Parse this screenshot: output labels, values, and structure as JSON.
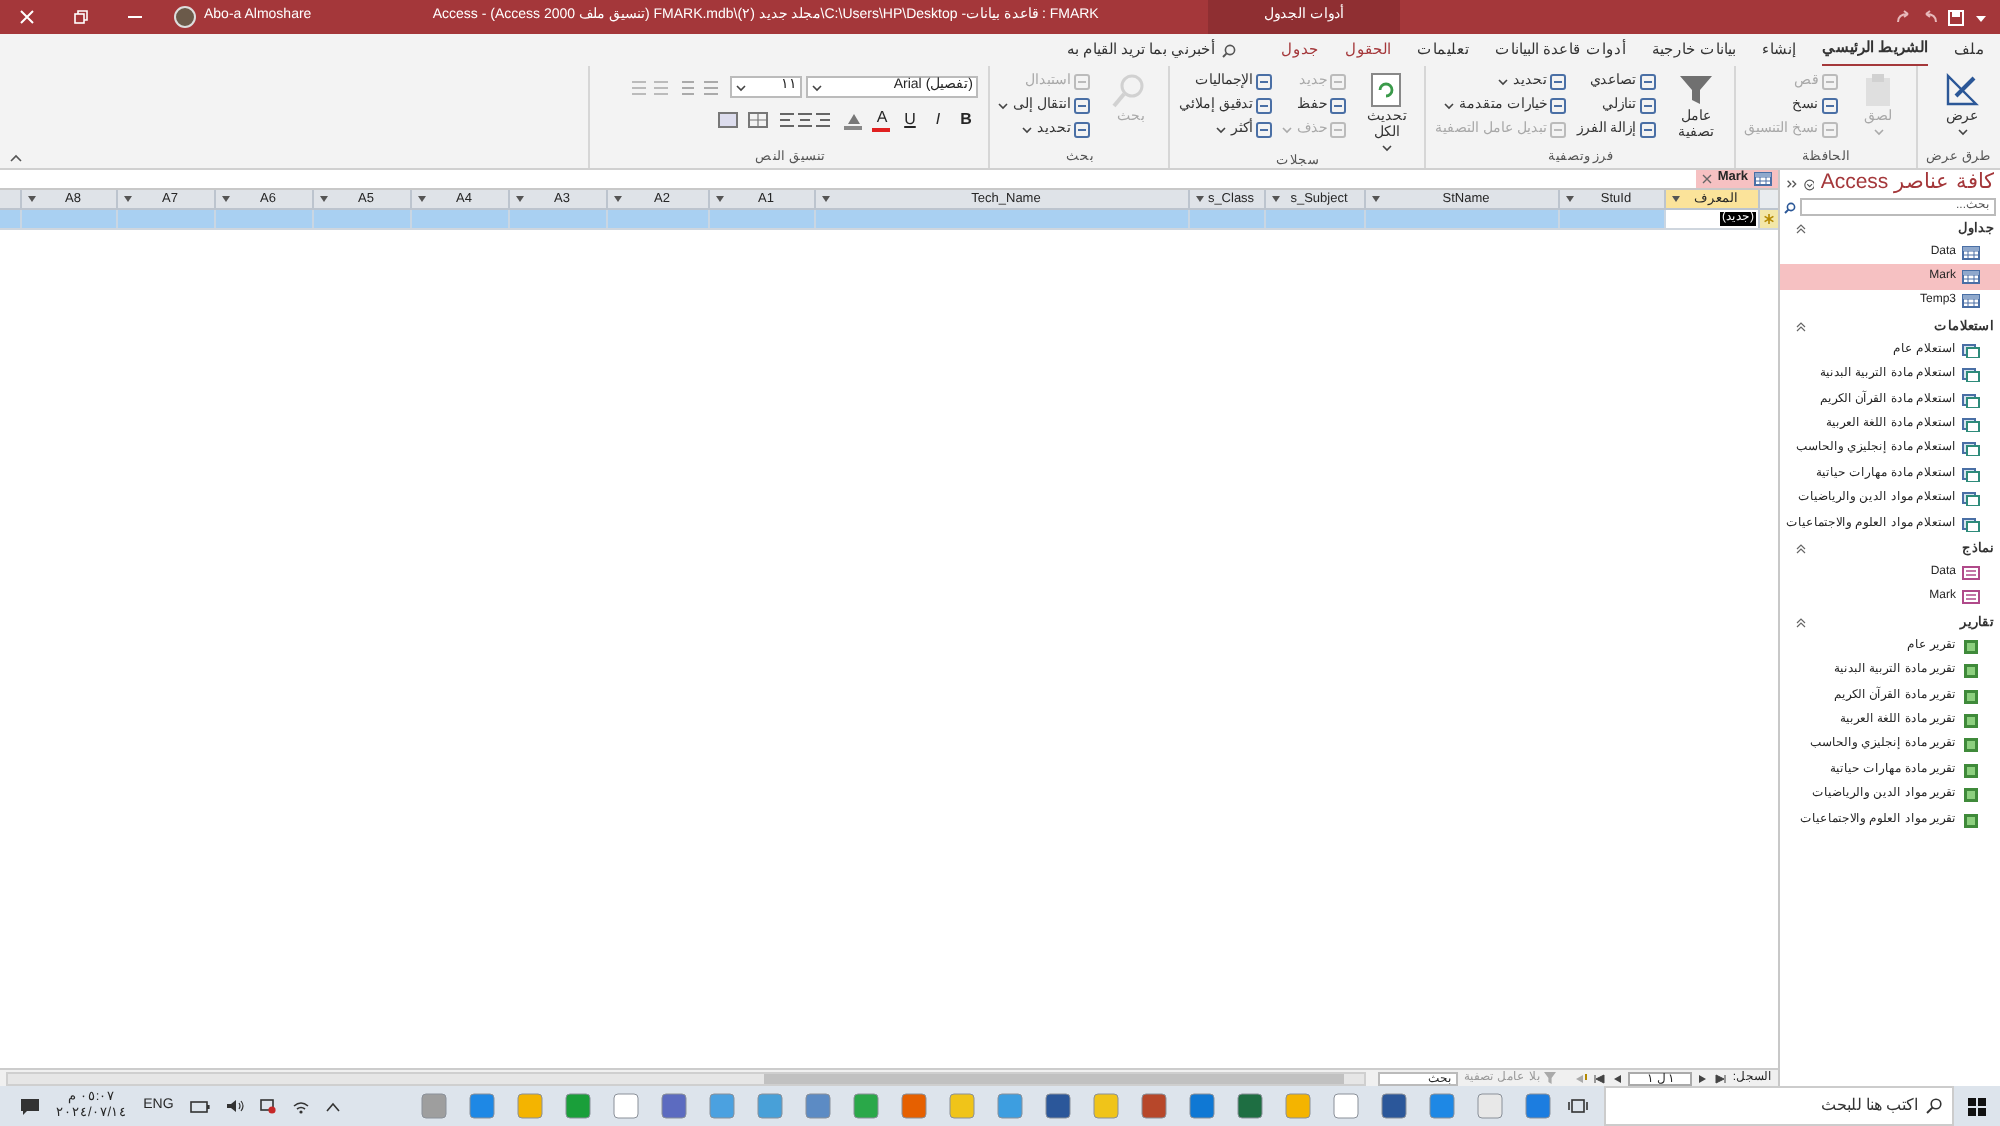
{
  "title_bar": {
    "user_name": "Abo-a Almoshare",
    "title": "FMARK : قاعدة بيانات- C:\\Users\\HP\\Desktop\\مجلد جديد (٢)\\FMARK.mdb (تنسيق ملف Access 2000) - Access",
    "context_tab": "أدوات الجدول"
  },
  "ribbon": {
    "tabs": [
      {
        "label": "ملف",
        "kind": "normal",
        "selected": false
      },
      {
        "label": "الشريط الرئيسي",
        "kind": "normal",
        "selected": true
      },
      {
        "label": "إنشاء",
        "kind": "normal",
        "selected": false
      },
      {
        "label": "بيانات خارجية",
        "kind": "normal",
        "selected": false
      },
      {
        "label": "أدوات قاعدة البيانات",
        "kind": "normal",
        "selected": false
      },
      {
        "label": "تعليمات",
        "kind": "normal",
        "selected": false
      },
      {
        "label": "الحقول",
        "kind": "context",
        "selected": false
      },
      {
        "label": "جدول",
        "kind": "context",
        "selected": false
      }
    ],
    "tell_me": "أخبرني بما تريد القيام به",
    "groups": [
      {
        "kind": "views",
        "label": "طرق عرض",
        "buttons": [
          {
            "label": "عرض",
            "kind": "large",
            "dropdown": true,
            "disabled": false
          }
        ]
      },
      {
        "kind": "clipboard",
        "label": "الحافظة",
        "buttons": [
          {
            "label": "لصق",
            "kind": "large",
            "dropdown": true,
            "disabled": true
          },
          {
            "label": "قص",
            "kind": "small",
            "dropdown": false,
            "disabled": true
          },
          {
            "label": "نسخ",
            "kind": "small",
            "dropdown": false,
            "disabled": false
          },
          {
            "label": "نسخ التنسيق",
            "kind": "small",
            "dropdown": false,
            "disabled": true
          }
        ]
      },
      {
        "kind": "sort",
        "label": "فرز وتصفية",
        "buttons": [
          {
            "label": "عامل تصفية",
            "kind": "large",
            "dropdown": false,
            "disabled": false
          },
          {
            "label": "تصاعدي",
            "kind": "small",
            "dropdown": false,
            "disabled": false
          },
          {
            "label": "تنازلي",
            "kind": "small",
            "dropdown": false,
            "disabled": false
          },
          {
            "label": "إزالة الفرز",
            "kind": "small",
            "dropdown": false,
            "disabled": false
          },
          {
            "label": "تحديد",
            "kind": "small",
            "dropdown": true,
            "disabled": false
          },
          {
            "label": "خيارات متقدمة",
            "kind": "small",
            "dropdown": true,
            "disabled": false
          },
          {
            "label": "تبديل عامل التصفية",
            "kind": "small",
            "dropdown": false,
            "disabled": true
          }
        ]
      },
      {
        "kind": "records",
        "label": "سجلات",
        "buttons": [
          {
            "label": "تحديث الكل",
            "kind": "large",
            "dropdown": true,
            "disabled": false
          },
          {
            "label": "جديد",
            "kind": "small",
            "dropdown": false,
            "disabled": true
          },
          {
            "label": "حفظ",
            "kind": "small",
            "dropdown": false,
            "disabled": false
          },
          {
            "label": "حذف",
            "kind": "small",
            "dropdown": true,
            "disabled": true
          },
          {
            "label": "الإجماليات",
            "kind": "small",
            "dropdown": false,
            "disabled": false
          },
          {
            "label": "تدقيق إملائي",
            "kind": "small",
            "dropdown": false,
            "disabled": false
          },
          {
            "label": "أكثر",
            "kind": "small",
            "dropdown": true,
            "disabled": false
          }
        ]
      },
      {
        "kind": "find",
        "label": "بحث",
        "buttons": [
          {
            "label": "بحث",
            "kind": "large",
            "dropdown": false,
            "disabled": true
          },
          {
            "label": "استبدال",
            "kind": "small",
            "dropdown": false,
            "disabled": true
          },
          {
            "label": "انتقال إلى",
            "kind": "small",
            "dropdown": true,
            "disabled": false
          },
          {
            "label": "تحديد",
            "kind": "small",
            "dropdown": true,
            "disabled": false
          }
        ]
      }
    ],
    "text_format": {
      "label": "تنسيق النص",
      "font": "(تفصيل) Arial",
      "size": "١١",
      "buttons": [
        {
          "label": "B",
          "kind": "bold"
        },
        {
          "label": "I",
          "kind": "italic"
        },
        {
          "label": "U",
          "kind": "underline"
        },
        {
          "label": "A",
          "kind": "font_color"
        }
      ]
    }
  },
  "nav_pane": {
    "title": "كافة عناصر Access",
    "search": {
      "placeholder": "بحث..."
    },
    "groups": [
      {
        "label": "جداول",
        "kind": "table",
        "items": [
          {
            "label": "Data",
            "selected": false
          },
          {
            "label": "Mark",
            "selected": true
          },
          {
            "label": "Temp3",
            "selected": false
          }
        ]
      },
      {
        "label": "استعلامات",
        "kind": "query",
        "items": [
          {
            "label": "استعلام عام",
            "selected": false
          },
          {
            "label": "استعلام مادة التربية البدنية",
            "selected": false
          },
          {
            "label": "استعلام مادة القرآن الكريم",
            "selected": false
          },
          {
            "label": "استعلام مادة اللغة العربية",
            "selected": false
          },
          {
            "label": "استعلام مادة إنجليزي والحاسب",
            "selected": false
          },
          {
            "label": "استعلام مادة مهارات حياتية",
            "selected": false
          },
          {
            "label": "استعلام مواد الدين والرياضيات",
            "selected": false
          },
          {
            "label": "استعلام مواد العلوم والاجتماعيات",
            "selected": false
          }
        ]
      },
      {
        "label": "نماذج",
        "kind": "form",
        "items": [
          {
            "label": "Data",
            "selected": false
          },
          {
            "label": "Mark",
            "selected": false
          }
        ]
      },
      {
        "label": "تقارير",
        "kind": "report",
        "items": [
          {
            "label": "تقرير عام",
            "selected": false
          },
          {
            "label": "تقرير مادة التربية البدنية",
            "selected": false
          },
          {
            "label": "تقرير مادة القرآن الكريم",
            "selected": false
          },
          {
            "label": "تقرير مادة اللغة العربية",
            "selected": false
          },
          {
            "label": "تقرير مادة إنجليزي والحاسب",
            "selected": false
          },
          {
            "label": "تقرير مادة مهارات حياتية",
            "selected": false
          },
          {
            "label": "تقرير مواد الدين والرياضيات",
            "selected": false
          },
          {
            "label": "تقرير مواد العلوم والاجتماعيات",
            "selected": false
          }
        ]
      }
    ]
  },
  "document_tab": {
    "label": "Mark"
  },
  "datasheet": {
    "columns": [
      {
        "label": "المعرف",
        "selected": true
      },
      {
        "label": "StuId",
        "selected": false
      },
      {
        "label": "StName",
        "selected": false
      },
      {
        "label": "s_Subject",
        "selected": false
      },
      {
        "label": "s_Class",
        "selected": false
      },
      {
        "label": "Tech_Name",
        "selected": false
      },
      {
        "label": "A1",
        "selected": false
      },
      {
        "label": "A2",
        "selected": false
      },
      {
        "label": "A3",
        "selected": false
      },
      {
        "label": "A4",
        "selected": false
      },
      {
        "label": "A5",
        "selected": false
      },
      {
        "label": "A6",
        "selected": false
      },
      {
        "label": "A7",
        "selected": false
      },
      {
        "label": "A8",
        "selected": false
      }
    ],
    "new_row": {
      "id_value": "(جديد)"
    }
  },
  "record_navigation": {
    "label": "السجل:",
    "position": "١ ل ١",
    "filter": "بلا عامل تصفية",
    "search": "بحث"
  },
  "taskbar": {
    "search_placeholder": "اكتب هنا للبحث",
    "language": "ENG",
    "time": "٠٥:٠٧ م",
    "date": "٢٠٢٤/٠٧/١٤"
  }
}
